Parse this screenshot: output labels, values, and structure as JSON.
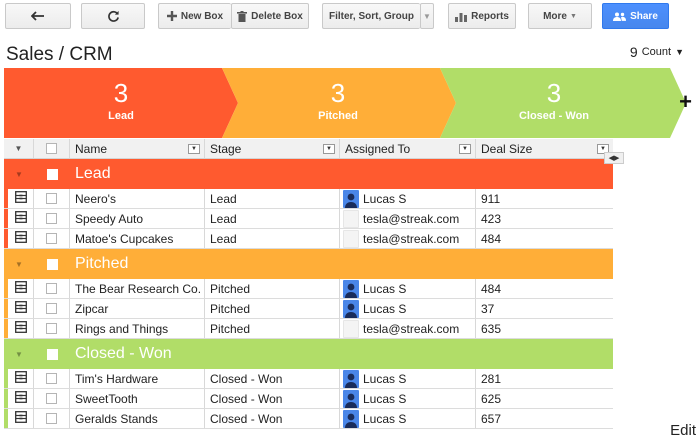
{
  "toolbar": {
    "new_box": "New Box",
    "delete_box": "Delete Box",
    "filter": "Filter, Sort, Group",
    "reports": "Reports",
    "more": "More",
    "share": "Share"
  },
  "header": {
    "title": "Sales / CRM",
    "count_value": "9",
    "count_label": "Count"
  },
  "pipeline": [
    {
      "count": "3",
      "label": "Lead",
      "color": "#ff5a2f"
    },
    {
      "count": "3",
      "label": "Pitched",
      "color": "#ffae38"
    },
    {
      "count": "3",
      "label": "Closed - Won",
      "color": "#b1dd68"
    }
  ],
  "add_stage": "+",
  "columns": [
    "Name",
    "Stage",
    "Assigned To",
    "Deal Size"
  ],
  "groups": [
    {
      "name": "Lead",
      "color": "#ff5a2f",
      "rows": [
        {
          "name": "Neero's",
          "stage": "Lead",
          "assigned": "Lucas S",
          "avatar": "person",
          "deal": "911"
        },
        {
          "name": "Speedy Auto",
          "stage": "Lead",
          "assigned": "tesla@streak.com",
          "avatar": "blank",
          "deal": "423"
        },
        {
          "name": "Matoe's Cupcakes",
          "stage": "Lead",
          "assigned": "tesla@streak.com",
          "avatar": "blank",
          "deal": "484"
        }
      ]
    },
    {
      "name": "Pitched",
      "color": "#ffae38",
      "rows": [
        {
          "name": "The Bear Research Co.",
          "stage": "Pitched",
          "assigned": "Lucas S",
          "avatar": "person",
          "deal": "484"
        },
        {
          "name": "Zipcar",
          "stage": "Pitched",
          "assigned": "Lucas S",
          "avatar": "person",
          "deal": "37"
        },
        {
          "name": "Rings and Things",
          "stage": "Pitched",
          "assigned": "tesla@streak.com",
          "avatar": "blank",
          "deal": "635"
        }
      ]
    },
    {
      "name": "Closed - Won",
      "color": "#b1dd68",
      "rows": [
        {
          "name": "Tim's Hardware",
          "stage": "Closed - Won",
          "assigned": "Lucas S",
          "avatar": "person",
          "deal": "281"
        },
        {
          "name": "SweetTooth",
          "stage": "Closed - Won",
          "assigned": "Lucas S",
          "avatar": "person",
          "deal": "625"
        },
        {
          "name": "Geralds Stands",
          "stage": "Closed - Won",
          "assigned": "Lucas S",
          "avatar": "person",
          "deal": "657"
        }
      ]
    }
  ],
  "edit_label": "Edit"
}
